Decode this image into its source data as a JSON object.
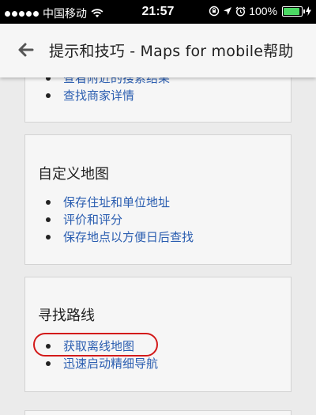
{
  "status_bar": {
    "carrier": "中国移动",
    "time": "21:57",
    "battery_text": "100%",
    "battery_level": 1.0
  },
  "header": {
    "back_icon": "arrow-left-icon",
    "title": "提示和技巧 - Maps for mobile帮助"
  },
  "cards": [
    {
      "title": "",
      "items": [
        {
          "label": "查看附近的搜索结果"
        },
        {
          "label": "查找商家详情"
        }
      ]
    },
    {
      "title": "自定义地图",
      "items": [
        {
          "label": "保存住址和单位地址"
        },
        {
          "label": "评价和评分"
        },
        {
          "label": "保存地点以方便日后查找"
        }
      ]
    },
    {
      "title": "寻找路线",
      "items": [
        {
          "label": "获取离线地图",
          "highlighted": true
        },
        {
          "label": "迅速启动精细导航"
        }
      ]
    }
  ],
  "colors": {
    "link": "#2a5db0",
    "highlight": "#d31a1a",
    "page_bg": "#ebebeb",
    "card_bg": "#f6f6f6"
  }
}
